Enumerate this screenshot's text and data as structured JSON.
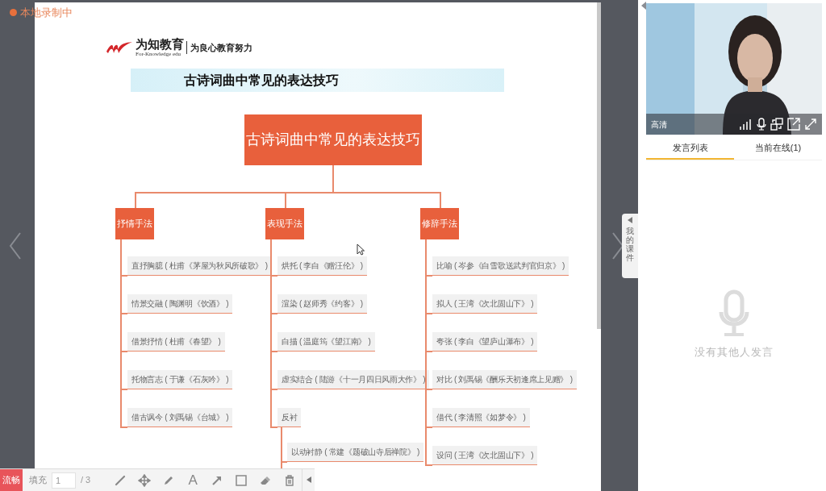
{
  "recording_indicator": {
    "label": "本地录制中"
  },
  "slide": {
    "logo": {
      "name": "为知教育",
      "subtitle": "For-Knowledge edu",
      "slogan": "为良心教育努力"
    },
    "banner_title": "古诗词曲中常见的表达技巧",
    "mind_map": {
      "root": "古诗词曲中常见的表达技巧",
      "branches": [
        {
          "label": "抒情手法",
          "children": [
            {
              "label": "直抒胸臆 ( 杜甫《茅屋为秋风所破歌》 )"
            },
            {
              "label": "情景交融 ( 陶渊明《饮酒》 )"
            },
            {
              "label": "借景抒情 ( 杜甫《春望》 )"
            },
            {
              "label": "托物言志 ( 于谦《石灰吟》 )"
            },
            {
              "label": "借古讽今 ( 刘禹锡《台城》 )"
            }
          ]
        },
        {
          "label": "表现手法",
          "children": [
            {
              "label": "烘托 ( 李白《赠汪伦》 )"
            },
            {
              "label": "渲染 ( 赵师秀《约客》 )"
            },
            {
              "label": "白描 ( 温庭筠《望江南》 )"
            },
            {
              "label": "虚实结合 ( 陆游《十一月四日风雨大作》 )"
            },
            {
              "label": "反衬",
              "children": [
                {
                  "label": "以动衬静 ( 常建《题破山寺后禅院》 )"
                }
              ]
            }
          ]
        },
        {
          "label": "修辞手法",
          "children": [
            {
              "label": "比喻 ( 岑参《白雪歌送武判官归京》 )"
            },
            {
              "label": "拟人 ( 王湾《次北固山下》 )"
            },
            {
              "label": "夸张 ( 李白《望庐山瀑布》 )"
            },
            {
              "label": "对比 ( 刘禹锡《酬乐天初逢席上见赠》 )"
            },
            {
              "label": "借代 ( 李清照《如梦令》 )"
            },
            {
              "label": "设问 ( 王湾《次北固山下》 )"
            }
          ]
        }
      ]
    }
  },
  "side_tab": {
    "label": "我的课件"
  },
  "video": {
    "kind": "picture",
    "quality_label": "高清"
  },
  "tabs": [
    {
      "label": "发言列表",
      "selected": true
    },
    {
      "label": "当前在线(1)",
      "selected": false
    }
  ],
  "empty_state": {
    "message": "没有其他人发言"
  },
  "toolbar": {
    "quality_button": "流畅",
    "fill_label": "填充",
    "page_input": "1",
    "page_total": "/ 3",
    "text_tool": "A"
  }
}
